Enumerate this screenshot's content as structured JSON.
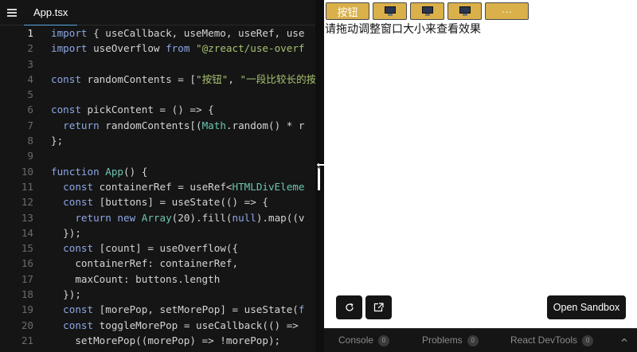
{
  "editor": {
    "tab_label": "App.tsx",
    "current_line": 1,
    "lines": [
      {
        "n": "1",
        "tokens": [
          [
            "kw",
            "import"
          ],
          [
            "",
            "{ useCallback, useMemo, useRef, use"
          ]
        ]
      },
      {
        "n": "2",
        "tokens": [
          [
            "kw",
            "import"
          ],
          [
            "",
            "useOverflow "
          ],
          [
            "kw",
            "from"
          ],
          [
            "",
            ""
          ],
          [
            "str",
            "\"@zreact/use-overf"
          ]
        ]
      },
      {
        "n": "3",
        "tokens": []
      },
      {
        "n": "4",
        "tokens": [
          [
            "kw",
            "const"
          ],
          [
            "",
            "randomContents = ["
          ],
          [
            "str",
            "\"按钮\""
          ],
          [
            "",
            ", "
          ],
          [
            "str",
            "\"一段比较长的按"
          ]
        ]
      },
      {
        "n": "5",
        "tokens": []
      },
      {
        "n": "6",
        "tokens": [
          [
            "kw",
            "const"
          ],
          [
            "",
            "pickContent = () => {"
          ]
        ]
      },
      {
        "n": "7",
        "tokens": [
          [
            "",
            "  "
          ],
          [
            "kw",
            "return"
          ],
          [
            "",
            "randomContents[("
          ],
          [
            "cls",
            "Math"
          ],
          [
            "",
            ".random() * r"
          ]
        ]
      },
      {
        "n": "8",
        "tokens": [
          [
            "",
            "};"
          ]
        ]
      },
      {
        "n": "9",
        "tokens": []
      },
      {
        "n": "10",
        "tokens": [
          [
            "kw",
            "function"
          ],
          [
            "",
            ""
          ],
          [
            "fn",
            "App"
          ],
          [
            "",
            "() {"
          ]
        ]
      },
      {
        "n": "11",
        "tokens": [
          [
            "",
            "  "
          ],
          [
            "kw",
            "const"
          ],
          [
            "",
            "containerRef = useRef<"
          ],
          [
            "cls",
            "HTMLDivEleme"
          ]
        ]
      },
      {
        "n": "12",
        "tokens": [
          [
            "",
            "  "
          ],
          [
            "kw",
            "const"
          ],
          [
            "",
            "[buttons] = useState(() => {"
          ]
        ]
      },
      {
        "n": "13",
        "tokens": [
          [
            "",
            "    "
          ],
          [
            "kw",
            "return new"
          ],
          [
            "",
            ""
          ],
          [
            "cls",
            "Array"
          ],
          [
            "",
            "(20).fill("
          ],
          [
            "kw",
            "null"
          ],
          [
            "",
            ").map((v"
          ]
        ]
      },
      {
        "n": "14",
        "tokens": [
          [
            "",
            "  });"
          ]
        ]
      },
      {
        "n": "15",
        "tokens": [
          [
            "",
            "  "
          ],
          [
            "kw",
            "const"
          ],
          [
            "",
            "[count] = useOverflow({"
          ]
        ]
      },
      {
        "n": "16",
        "tokens": [
          [
            "",
            "    containerRef: containerRef,"
          ]
        ]
      },
      {
        "n": "17",
        "tokens": [
          [
            "",
            "    maxCount: buttons.length"
          ]
        ]
      },
      {
        "n": "18",
        "tokens": [
          [
            "",
            "  });"
          ]
        ]
      },
      {
        "n": "19",
        "tokens": [
          [
            "",
            "  "
          ],
          [
            "kw",
            "const"
          ],
          [
            "",
            "[morePop, setMorePop] = useState("
          ],
          [
            "kw",
            "f"
          ]
        ]
      },
      {
        "n": "20",
        "tokens": [
          [
            "",
            "  "
          ],
          [
            "kw",
            "const"
          ],
          [
            "",
            "toggleMorePop = useCallback(() =>"
          ]
        ]
      },
      {
        "n": "21",
        "tokens": [
          [
            "",
            "    setMorePop((morePop) => !morePop);"
          ]
        ]
      }
    ]
  },
  "preview": {
    "buttons": [
      {
        "kind": "text",
        "label": "按钮"
      },
      {
        "kind": "icon",
        "icon": "monitor-icon"
      },
      {
        "kind": "icon",
        "icon": "monitor-icon"
      },
      {
        "kind": "icon",
        "icon": "monitor-icon"
      },
      {
        "kind": "text",
        "label": "···"
      }
    ],
    "hint_text": "请拖动调整窗口大小来查看效果",
    "refresh_icon": "refresh-icon",
    "open_new_window_icon": "external-link-icon",
    "open_sandbox_label": "Open Sandbox"
  },
  "devtools": {
    "tabs": [
      {
        "label": "Console",
        "count": "0"
      },
      {
        "label": "Problems",
        "count": "0"
      },
      {
        "label": "React DevTools",
        "count": "0"
      }
    ],
    "expand_icon": "chevron-up-icon"
  },
  "colors": {
    "button_fill": "#d9b04a",
    "editor_bg": "#151515",
    "keyword": "#8da7e6",
    "string": "#a8c070",
    "function": "#6cc5b0"
  }
}
